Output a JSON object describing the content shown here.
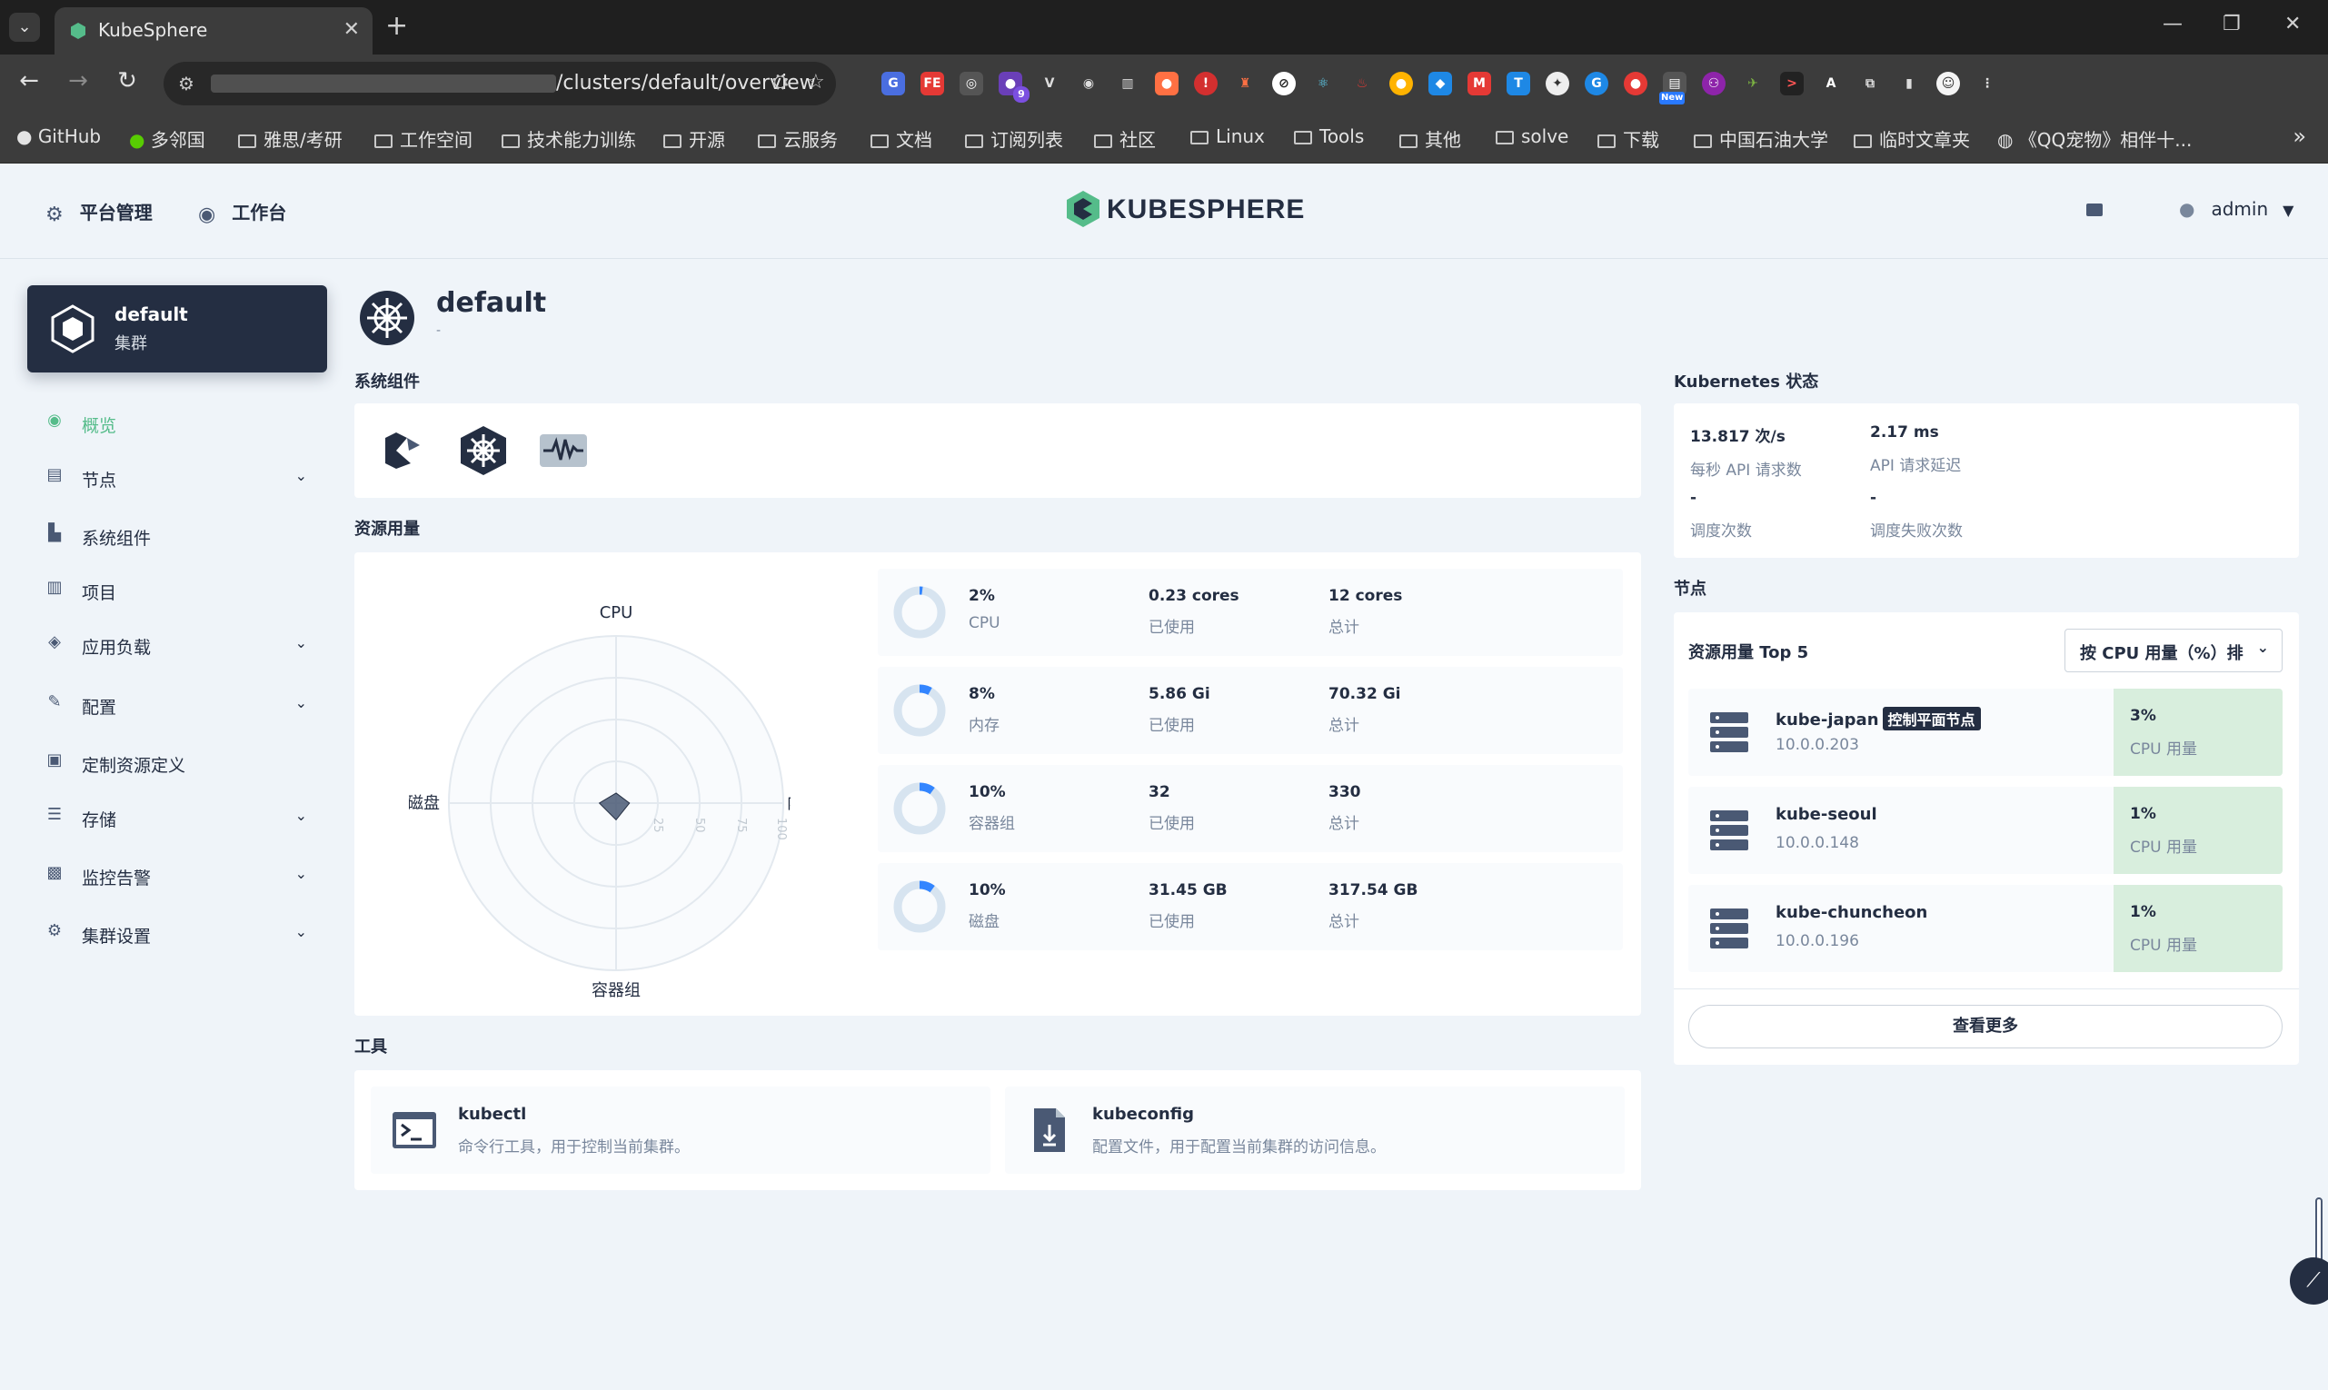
{
  "browser": {
    "tab_title": "KubeSphere",
    "url": "/clusters/default/overview",
    "bookmarks": [
      "GitHub",
      "多邻国",
      "雅思/考研",
      "工作空间",
      "技术能力训练",
      "开源",
      "云服务",
      "文档",
      "订阅列表",
      "社区",
      "Linux",
      "Tools",
      "其他",
      "solve",
      "下载",
      "中国石油大学",
      "临时文章夹",
      "《QQ宠物》相伴十..."
    ],
    "extension_badges": {
      "count": "9",
      "new": "New"
    }
  },
  "header": {
    "platform": "平台管理",
    "workbench": "工作台",
    "logo": "KUBESPHERE",
    "user": "admin"
  },
  "cluster": {
    "name": "default",
    "type": "集群"
  },
  "sidebar": {
    "items": [
      {
        "label": "概览"
      },
      {
        "label": "节点"
      },
      {
        "label": "系统组件"
      },
      {
        "label": "项目"
      },
      {
        "label": "应用负载"
      },
      {
        "label": "配置"
      },
      {
        "label": "定制资源定义"
      },
      {
        "label": "存储"
      },
      {
        "label": "监控告警"
      },
      {
        "label": "集群设置"
      }
    ]
  },
  "page": {
    "title": "default",
    "subtitle": "-"
  },
  "sections": {
    "components": "系统组件",
    "resources": "资源用量",
    "tools": "工具",
    "kubernetes": "Kubernetes 状态",
    "nodes": "节点"
  },
  "radar": {
    "labels": {
      "top": "CPU",
      "right": "内存",
      "bottom": "容器组",
      "left": "磁盘"
    },
    "ticks": [
      "25",
      "50",
      "75",
      "100"
    ],
    "values": {
      "cpu": 2,
      "memory": 8,
      "pods": 10,
      "disk": 10
    }
  },
  "resources": [
    {
      "percent_label": "2%",
      "percent": 2,
      "name": "CPU",
      "used": "0.23 cores",
      "used_label": "已使用",
      "total": "12 cores",
      "total_label": "总计"
    },
    {
      "percent_label": "8%",
      "percent": 8,
      "name": "内存",
      "used": "5.86 Gi",
      "used_label": "已使用",
      "total": "70.32 Gi",
      "total_label": "总计"
    },
    {
      "percent_label": "10%",
      "percent": 10,
      "name": "容器组",
      "used": "32",
      "used_label": "已使用",
      "total": "330",
      "total_label": "总计"
    },
    {
      "percent_label": "10%",
      "percent": 10,
      "name": "磁盘",
      "used": "31.45 GB",
      "used_label": "已使用",
      "total": "317.54 GB",
      "total_label": "总计"
    }
  ],
  "kubernetes": [
    {
      "value": "13.817 次/s",
      "label": "每秒 API 请求数"
    },
    {
      "value": "2.17 ms",
      "label": "API 请求延迟"
    },
    {
      "value": "-",
      "label": "调度次数"
    },
    {
      "value": "-",
      "label": "调度失败次数"
    }
  ],
  "nodes": {
    "top_title": "资源用量 Top 5",
    "sort_label": "按 CPU 用量（%）排",
    "list": [
      {
        "name": "kube-japan",
        "badge": "控制平面节点",
        "ip": "10.0.0.203",
        "usage": "3%",
        "usage_label": "CPU 用量"
      },
      {
        "name": "kube-seoul",
        "badge": "",
        "ip": "10.0.0.148",
        "usage": "1%",
        "usage_label": "CPU 用量"
      },
      {
        "name": "kube-chuncheon",
        "badge": "",
        "ip": "10.0.0.196",
        "usage": "1%",
        "usage_label": "CPU 用量"
      }
    ],
    "more": "查看更多"
  },
  "tools": [
    {
      "name": "kubectl",
      "desc": "命令行工具，用于控制当前集群。"
    },
    {
      "name": "kubeconfig",
      "desc": "配置文件，用于配置当前集群的访问信息。"
    }
  ],
  "colors": {
    "accent": "#55bc8a",
    "dark": "#242e42",
    "donut": "#3385ff",
    "donut_track": "#d7e4f0",
    "node_usage_bg": "#d8eedd"
  }
}
